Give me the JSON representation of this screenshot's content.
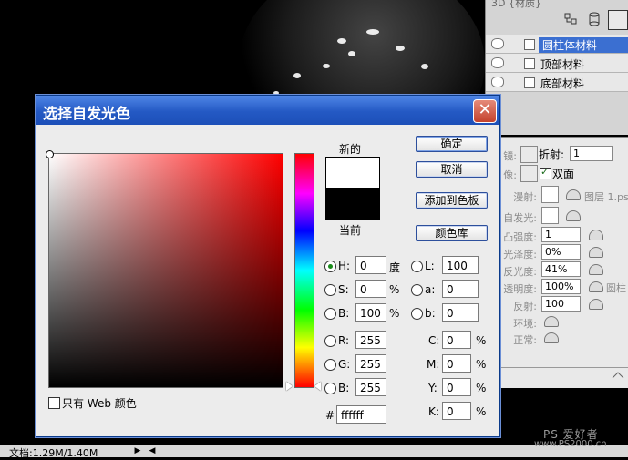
{
  "background": {
    "watermark": "PS 爱好者",
    "watermark_url": "www.PS2000.cn",
    "status_text": "文档:1.29M/1.40M"
  },
  "layers_panel": {
    "title_partial": "3D {材质}",
    "layers": [
      {
        "label": "圆柱体材料",
        "selected": true
      },
      {
        "label": "顶部材料",
        "selected": false
      },
      {
        "label": "底部材料",
        "selected": false
      }
    ]
  },
  "material_panel": {
    "refraction_label": "折射:",
    "refraction_value": "1",
    "double_sided_label": "双面",
    "double_sided_checked": true,
    "env_partial_1": "镜:",
    "env_partial_2": "像:",
    "rows": [
      {
        "label": "漫射:",
        "extra": "图层 1.ps"
      },
      {
        "label": "自发光:",
        "extra": ""
      },
      {
        "label": "凸强度:",
        "value": "1"
      },
      {
        "label": "光泽度:",
        "value": "0%"
      },
      {
        "label": "反光度:",
        "value": "41%"
      },
      {
        "label": "透明度:",
        "value": "100%",
        "extra": "圆柱"
      },
      {
        "label": "反射:",
        "value": "100"
      },
      {
        "label": "环境:"
      },
      {
        "label": "正常:"
      }
    ]
  },
  "dialog": {
    "title": "选择自发光色",
    "new_label": "新的",
    "current_label": "当前",
    "buttons": {
      "ok": "确定",
      "cancel": "取消",
      "add_to_swatches": "添加到色板",
      "color_libraries": "颜色库"
    },
    "hsb": {
      "h": {
        "label": "H:",
        "value": "0",
        "unit": "度",
        "selected": true
      },
      "s": {
        "label": "S:",
        "value": "0",
        "unit": "%"
      },
      "b": {
        "label": "B:",
        "value": "100",
        "unit": "%"
      }
    },
    "rgb": {
      "r": {
        "label": "R:",
        "value": "255"
      },
      "g": {
        "label": "G:",
        "value": "255"
      },
      "b": {
        "label": "B:",
        "value": "255"
      }
    },
    "lab": {
      "l": {
        "label": "L:",
        "value": "100"
      },
      "a": {
        "label": "a:",
        "value": "0"
      },
      "b": {
        "label": "b:",
        "value": "0"
      }
    },
    "cmyk": {
      "c": {
        "label": "C:",
        "value": "0",
        "unit": "%"
      },
      "m": {
        "label": "M:",
        "value": "0",
        "unit": "%"
      },
      "y": {
        "label": "Y:",
        "value": "0",
        "unit": "%"
      },
      "k": {
        "label": "K:",
        "value": "0",
        "unit": "%"
      }
    },
    "hex_label": "#",
    "hex_value": "ffffff",
    "web_only_label": "只有 Web 颜色",
    "web_only_checked": false
  }
}
